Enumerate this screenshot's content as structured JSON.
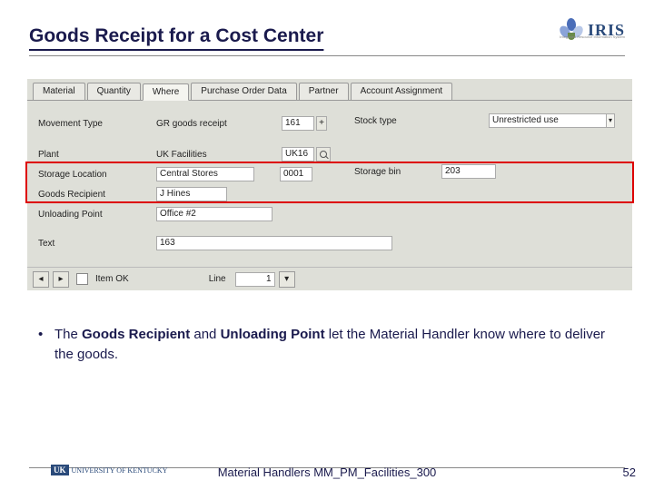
{
  "header": {
    "title": "Goods Receipt for a Cost Center",
    "logo_text": "IRIS",
    "logo_sub": "Integrated Resource Information System"
  },
  "sap": {
    "tabs": [
      "Material",
      "Quantity",
      "Where",
      "Purchase Order Data",
      "Partner",
      "Account Assignment"
    ],
    "active_tab": "Where",
    "movement_type_lbl": "Movement Type",
    "movement_type_val": "GR goods receipt",
    "movement_type_code": "161",
    "plus": "+",
    "stock_type_lbl": "Stock type",
    "stock_type_val": "Unrestricted use",
    "plant_lbl": "Plant",
    "plant_val": "UK Facilities",
    "plant_code": "UK16",
    "storage_loc_lbl": "Storage Location",
    "storage_loc_val": "Central Stores",
    "storage_loc_code": "0001",
    "storage_bin_lbl": "Storage bin",
    "storage_bin_val": "203",
    "goods_recip_lbl": "Goods Recipient",
    "goods_recip_val": "J Hines",
    "unload_lbl": "Unloading Point",
    "unload_val": "Office #2",
    "text_lbl": "Text",
    "text_val": "163",
    "item_ok_lbl": "Item OK",
    "line_lbl": "Line",
    "line_val": "1"
  },
  "bullet": {
    "pre": "The ",
    "b1": "Goods Recipient",
    "mid": " and ",
    "b2": "Unloading Point",
    "post": " let the Material Handler know where to deliver the goods."
  },
  "footer": {
    "uk": "UNIVERSITY OF KENTUCKY",
    "center": "Material Handlers MM_PM_Facilities_300",
    "page": "52"
  }
}
